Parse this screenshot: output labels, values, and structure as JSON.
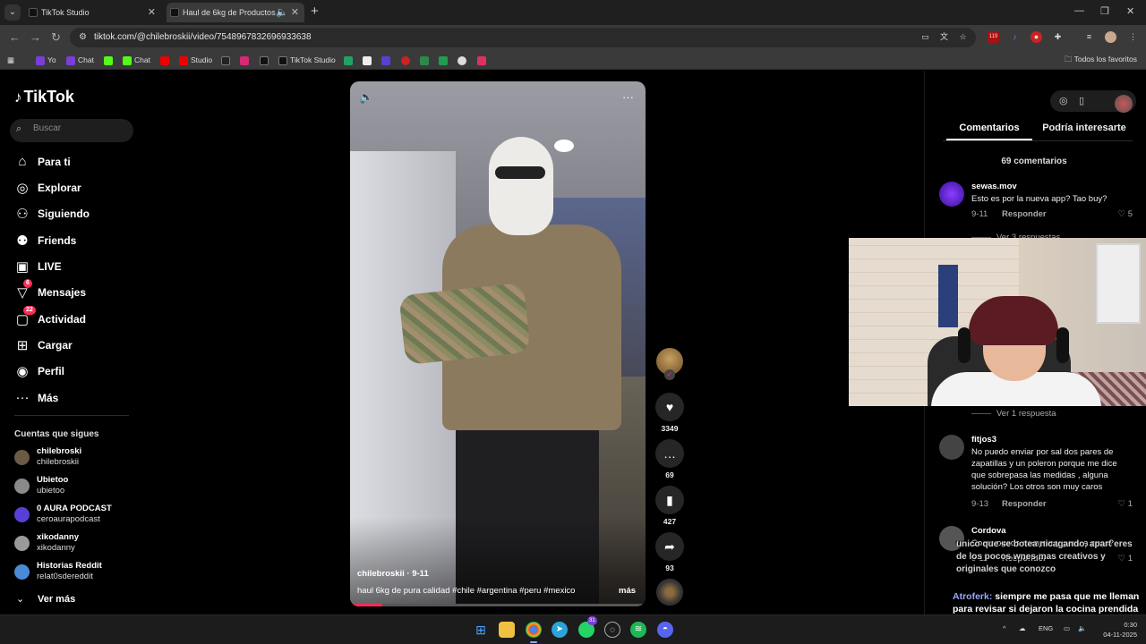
{
  "browser": {
    "tabs": [
      {
        "title": "TikTok Studio"
      },
      {
        "title": "Haul de 6kg de Productos d"
      }
    ],
    "url": "tiktok.com/@chilebroskii/video/7548967832696933638",
    "extension_badge": "119",
    "bookmarks": [
      "Yo",
      "Chat",
      "Chat",
      "Studio",
      "TikTok Studio"
    ],
    "bookmarks_all": "Todos los favoritos"
  },
  "sidebar": {
    "logo": "TikTok",
    "search_placeholder": "Buscar",
    "nav": [
      {
        "label": "Para ti",
        "icon": "home-icon"
      },
      {
        "label": "Explorar",
        "icon": "compass-icon"
      },
      {
        "label": "Siguiendo",
        "icon": "following-icon"
      },
      {
        "label": "Friends",
        "icon": "friends-icon"
      },
      {
        "label": "LIVE",
        "icon": "live-icon"
      },
      {
        "label": "Mensajes",
        "icon": "messages-icon",
        "badge": "6"
      },
      {
        "label": "Actividad",
        "icon": "activity-icon",
        "badge": "22"
      },
      {
        "label": "Cargar",
        "icon": "upload-icon"
      },
      {
        "label": "Perfil",
        "icon": "profile-icon"
      },
      {
        "label": "Más",
        "icon": "more-icon"
      }
    ],
    "following_title": "Cuentas que sigues",
    "accounts": [
      {
        "name": "chilebroski",
        "handle": "chilebroskii",
        "color": "#6b5a44"
      },
      {
        "name": "Ubietoo",
        "handle": "ubietoo",
        "color": "#8a8a8a"
      },
      {
        "name": "0 AURA PODCAST",
        "handle": "ceroaurapodcast",
        "color": "#5a3fd6"
      },
      {
        "name": "xikodanny",
        "handle": "xikodanny",
        "color": "#9a9a9a"
      },
      {
        "name": "Historias Reddit",
        "handle": "relat0sdereddit",
        "color": "#4a8ad6"
      }
    ],
    "see_more": "Ver más"
  },
  "video": {
    "author_line": "chilebroskii · 9-11",
    "caption": "haul 6kg de pura calidad #chile #argentina #peru #mexico",
    "more": "más",
    "progress_fraction": 0.11
  },
  "actions": {
    "likes": "3349",
    "comments": "69",
    "saves": "427",
    "shares": "93"
  },
  "comments_panel": {
    "tab_comments": "Comentarios",
    "tab_other": "Podría interesarte",
    "count": "69 comentarios",
    "comments": [
      {
        "user": "sewas.mov",
        "text": "Esto es por la nueva app? Tao buy?",
        "date": "9-11",
        "reply": "Responder",
        "likes": "5",
        "color": "#5a1fd6"
      },
      {
        "user": "fitjos3",
        "text": "No puedo enviar por sal dos pares de zapatillas y un poleron porque me dice que sobrepasa las medidas , alguna solución? Los otros son muy caros",
        "date": "9-13",
        "reply": "Responder",
        "likes": "1",
        "color": "#444"
      },
      {
        "user": "Cordova",
        "text": "Como puedo comprar y paso a paso?",
        "date": "9-11",
        "reply": "Responder",
        "likes": "1",
        "color": "#555"
      }
    ],
    "replies_1": "Ver 3 respuestas",
    "replies_2": "Ver 1 respuesta"
  },
  "overlay": {
    "ghost_text": "unico que se botea nicagando, apart eres de los pocos wnes mas creativos y originales que conozco",
    "chat_name": "Atroferk:",
    "chat_text": "siempre me pasa que me lleman para revisar si dejaron la cocina prendida y nunca la dejan prendida y voy a revisar de puro wn"
  },
  "taskbar": {
    "whatsapp_badge": "31",
    "lang": "ENG",
    "time": "0:30",
    "date": "04-11-2025"
  }
}
